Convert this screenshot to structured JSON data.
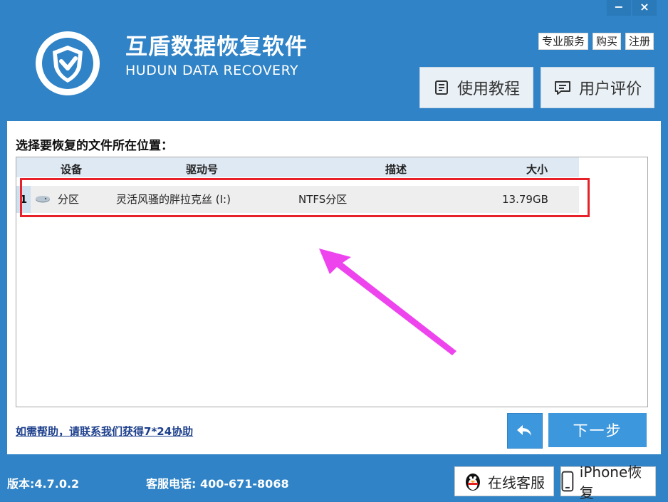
{
  "window": {
    "minimize_label": "−",
    "close_label": "×"
  },
  "header": {
    "title": "互盾数据恢复软件",
    "subtitle": "HUDUN DATA RECOVERY",
    "links": [
      "专业服务",
      "购买",
      "注册"
    ],
    "tutorial_label": "使用教程",
    "review_label": "用户评价",
    "logo_icon": "shield-check-icon"
  },
  "main": {
    "prompt": "选择要恢复的文件所在位置：",
    "columns": [
      "设备",
      "驱动号",
      "描述",
      "大小"
    ],
    "rows": [
      {
        "index": "1",
        "device": "分区",
        "drive": "灵活风骚的胖拉克丝 (I:)",
        "description": "NTFS分区",
        "size": "13.79GB"
      }
    ],
    "help_text": "如需帮助，请联系我们获得7*24协助",
    "back_icon": "back-arrow-icon",
    "next_label": "下一步"
  },
  "footer": {
    "version": "版本:4.7.0.2",
    "hotline": "客服电话: 400-671-8068",
    "service_label": "在线客服",
    "iphone_label": "iPhone恢复"
  },
  "colors": {
    "brand": "#2f83c6",
    "highlight_box": "#e8202a",
    "annotation_arrow": "#ee44ee"
  }
}
